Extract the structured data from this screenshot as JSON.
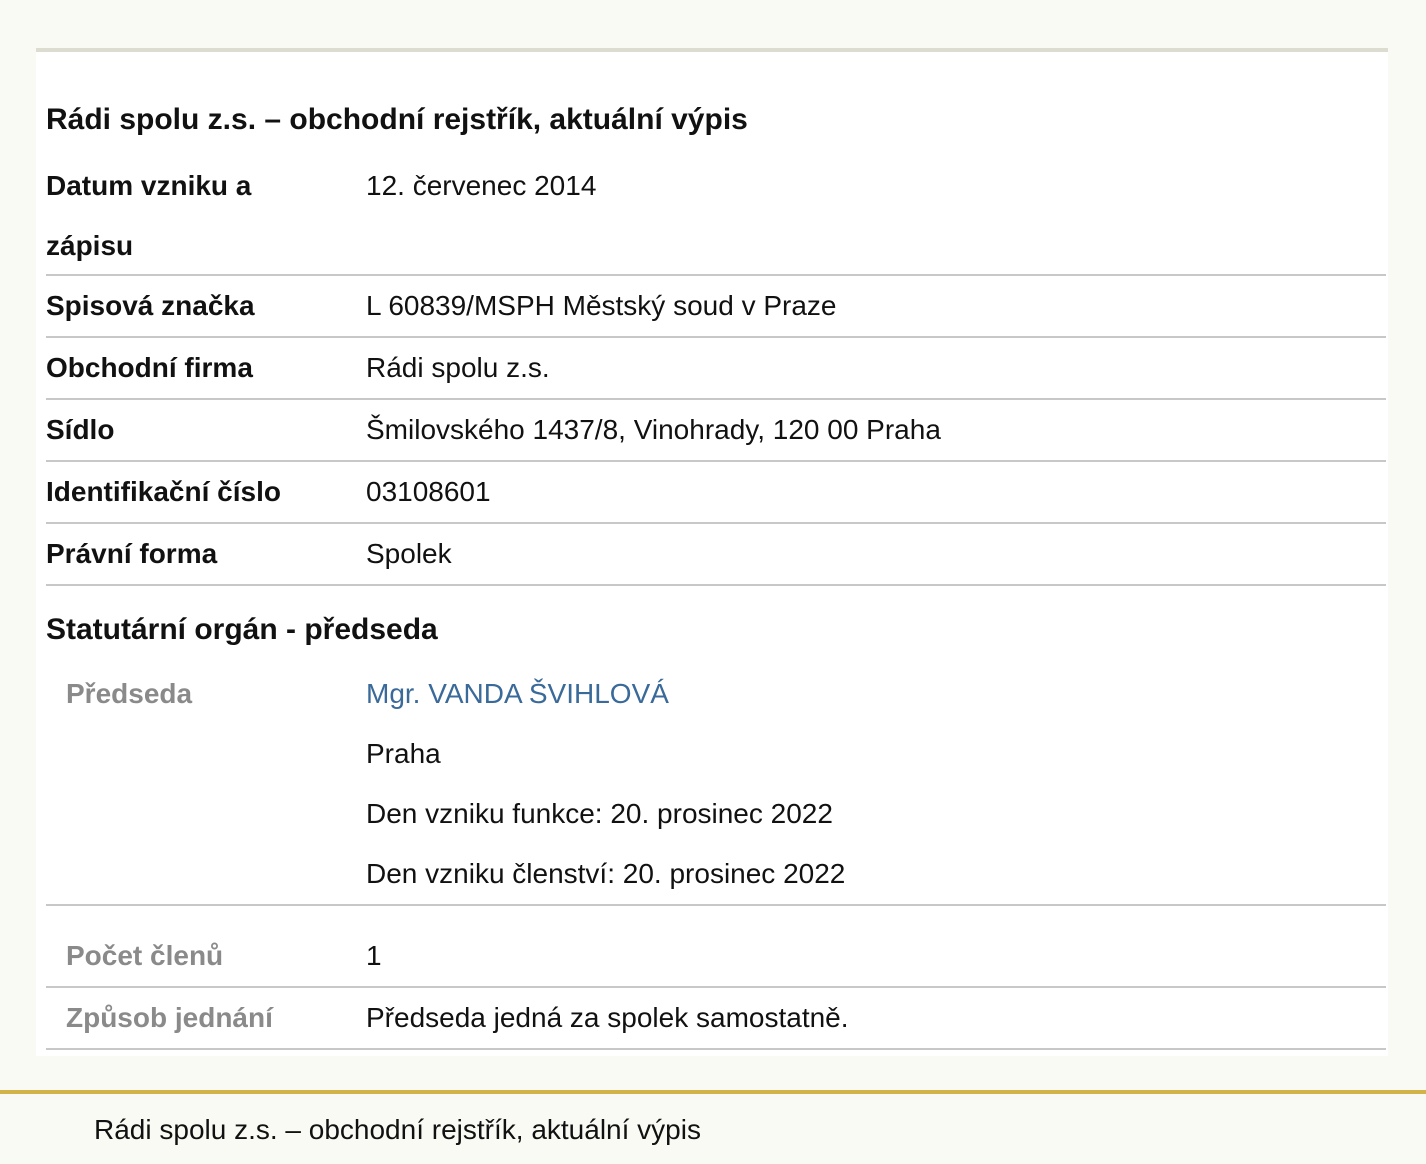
{
  "card": {
    "title": "Rádi spolu z.s. – obchodní rejstřík, aktuální výpis",
    "rows": [
      {
        "label": "Datum vzniku a zápisu",
        "value": "12. červenec 2014"
      },
      {
        "label": "Spisová značka",
        "value": "L 60839/MSPH Městský soud v Praze"
      },
      {
        "label": "Obchodní firma",
        "value": "Rádi spolu z.s."
      },
      {
        "label": "Sídlo",
        "value": "Šmilovského 1437/8, Vinohrady, 120 00 Praha"
      },
      {
        "label": "Identifikační číslo",
        "value": "03108601"
      },
      {
        "label": "Právní forma",
        "value": "Spolek"
      }
    ],
    "statutory": {
      "title": "Statutární orgán - předseda",
      "chair": {
        "label": "Předseda",
        "name": "Mgr. VANDA ŠVIHLOVÁ",
        "city": "Praha",
        "function_start": "Den vzniku funkce: 20. prosinec 2022",
        "membership_start": "Den vzniku členství: 20. prosinec 2022"
      },
      "members": {
        "label": "Počet členů",
        "value": "1"
      },
      "conduct": {
        "label": "Způsob jednání",
        "value": "Předseda jedná za spolek samostatně."
      }
    }
  },
  "footer": {
    "text": "Rádi spolu z.s. – obchodní rejstřík, aktuální výpis"
  },
  "colors": {
    "link": "#3a6a99",
    "footer_border": "#d4b24a",
    "sub_label": "#8a8a8a"
  }
}
